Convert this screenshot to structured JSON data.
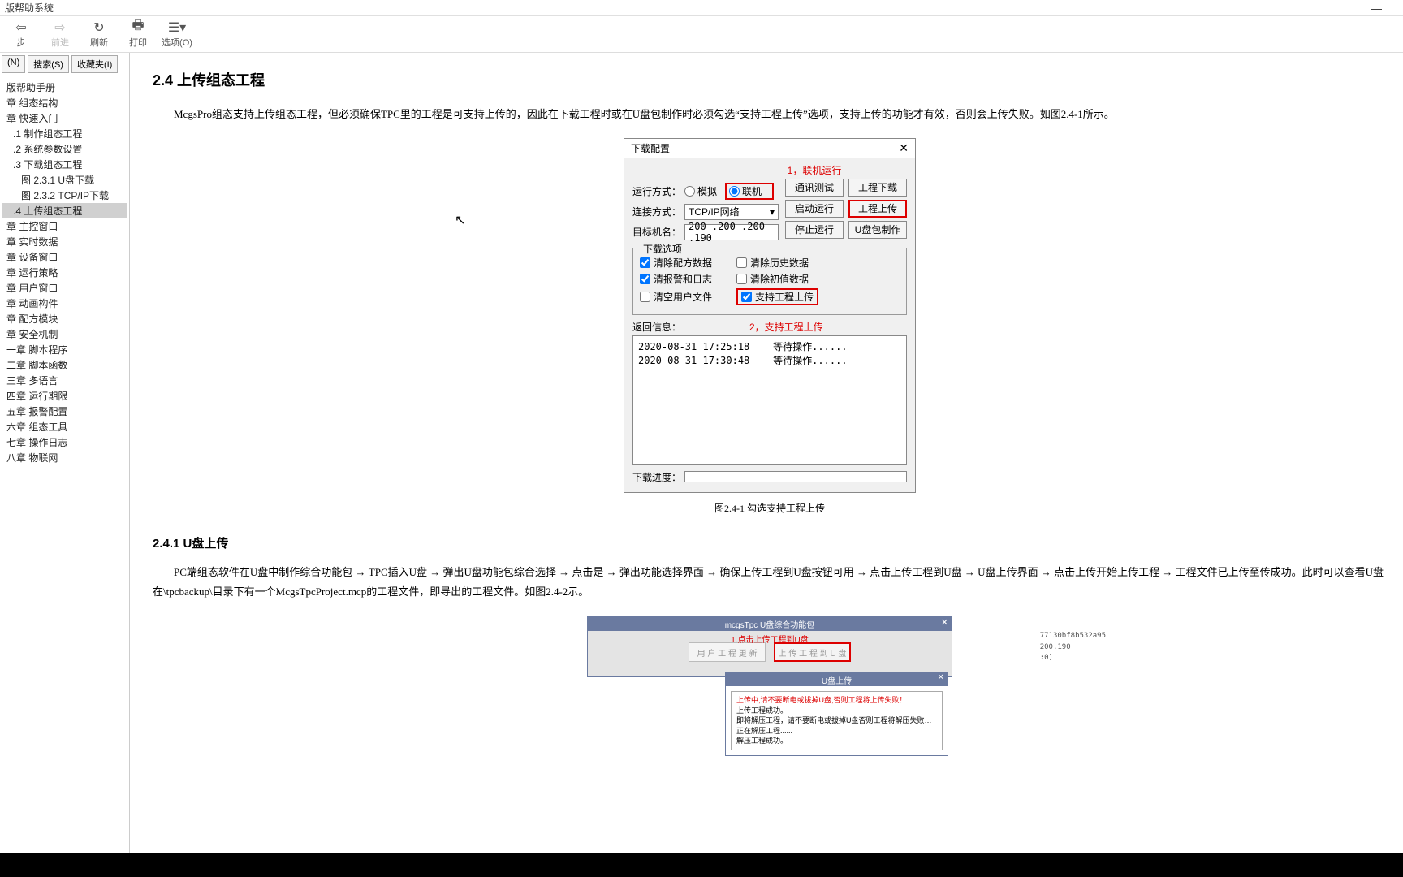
{
  "window_title": "版帮助系统",
  "toolbar": {
    "back": "步",
    "forward": "前进",
    "refresh": "刷新",
    "print": "打印",
    "options": "选项(O)"
  },
  "sidebar_tabs": {
    "t1": "(N)",
    "t2": "搜索(S)",
    "t3": "收藏夹(I)"
  },
  "tree": [
    {
      "l": 1,
      "t": "版帮助手册"
    },
    {
      "l": 1,
      "t": "章 组态结构"
    },
    {
      "l": 1,
      "t": "章 快速入门"
    },
    {
      "l": 2,
      "t": ".1 制作组态工程"
    },
    {
      "l": 2,
      "t": ".2 系统参数设置"
    },
    {
      "l": 2,
      "t": ".3 下载组态工程"
    },
    {
      "l": 3,
      "t": "图 2.3.1 U盘下载"
    },
    {
      "l": 3,
      "t": "图 2.3.2 TCP/IP下载"
    },
    {
      "l": 2,
      "t": ".4 上传组态工程",
      "sel": true
    },
    {
      "l": 1,
      "t": "章 主控窗口"
    },
    {
      "l": 1,
      "t": "章 实时数据"
    },
    {
      "l": 1,
      "t": "章 设备窗口"
    },
    {
      "l": 1,
      "t": "章 运行策略"
    },
    {
      "l": 1,
      "t": "章 用户窗口"
    },
    {
      "l": 1,
      "t": "章 动画构件"
    },
    {
      "l": 1,
      "t": "章 配方模块"
    },
    {
      "l": 1,
      "t": "章 安全机制"
    },
    {
      "l": 1,
      "t": "一章 脚本程序"
    },
    {
      "l": 1,
      "t": "二章 脚本函数"
    },
    {
      "l": 1,
      "t": "三章 多语言"
    },
    {
      "l": 1,
      "t": "四章 运行期限"
    },
    {
      "l": 1,
      "t": "五章 报警配置"
    },
    {
      "l": 1,
      "t": "六章 组态工具"
    },
    {
      "l": 1,
      "t": "七章 操作日志"
    },
    {
      "l": 1,
      "t": "八章 物联网"
    }
  ],
  "content": {
    "h2": "2.4  上传组态工程",
    "p1": "McgsPro组态支持上传组态工程，但必须确保TPC里的工程是可支持上传的，因此在下载工程时或在U盘包制作时必须勾选“支持工程上传”选项，支持上传的功能才有效，否则会上传失败。如图2.4-1所示。",
    "fig1": "图2.4-1 勾选支持工程上传",
    "h3": "2.4.1  U盘上传",
    "p2": "PC端组态软件在U盘中制作综合功能包 → TPC插入U盘 → 弹出U盘功能包综合选择 → 点击是 → 弹出功能选择界面 → 确保上传工程到U盘按钮可用 → 点击上传工程到U盘 → U盘上传界面 → 点击上传开始上传工程 → 工程文件已上传至传成功。此时可以查看U盘在\\tpcbackup\\目录下有一个McgsTpcProject.mcp的工程文件，即导出的工程文件。如图2.4-2示。"
  },
  "dialog": {
    "title": "下载配置",
    "note1": "1，联机运行",
    "run_mode_label": "运行方式：",
    "radio_sim": "模拟",
    "radio_online": "联机",
    "conn_label": "连接方式：",
    "conn_value": "TCP/IP网络",
    "target_label": "目标机名：",
    "target_value": "200 .200 .200 .190",
    "btn_test": "通讯测试",
    "btn_download": "工程下载",
    "btn_start": "启动运行",
    "btn_upload": "工程上传",
    "btn_stop": "停止运行",
    "btn_usb": "U盘包制作",
    "fieldset": "下载选项",
    "chk_recipe": "清除配方数据",
    "chk_hist": "清除历史数据",
    "chk_alarm": "清报警和日志",
    "chk_init": "清除初值数据",
    "chk_user": "清空用户文件",
    "chk_support": "支持工程上传",
    "ret_label": "返回信息：",
    "note2": "2，支持工程上传",
    "log": "2020-08-31 17:25:18    等待操作......\n2020-08-31 17:30:48    等待操作......",
    "progress_label": "下载进度："
  },
  "img2": {
    "title_a": "mcgsTpc  U盘综合功能包",
    "rednote": "1.点击上传工程到U盘",
    "btn_left": "用 户 工 程 更 新",
    "btn_right": "上 传 工 程 到 U 盘",
    "side1": "77130bf8b532a95",
    "side2": "200.190",
    "side3": ":0)",
    "title_b": "U盘上传",
    "msg_red": "上传中,请不要断电或拔掉U盘,否则工程将上传失败！",
    "msg1": "上传工程成功。",
    "msg2": "即将解压工程，请不要断电或拔掉U盘否则工程将解压失败…",
    "msg3": "正在解压工程......",
    "msg4": "解压工程成功。"
  }
}
